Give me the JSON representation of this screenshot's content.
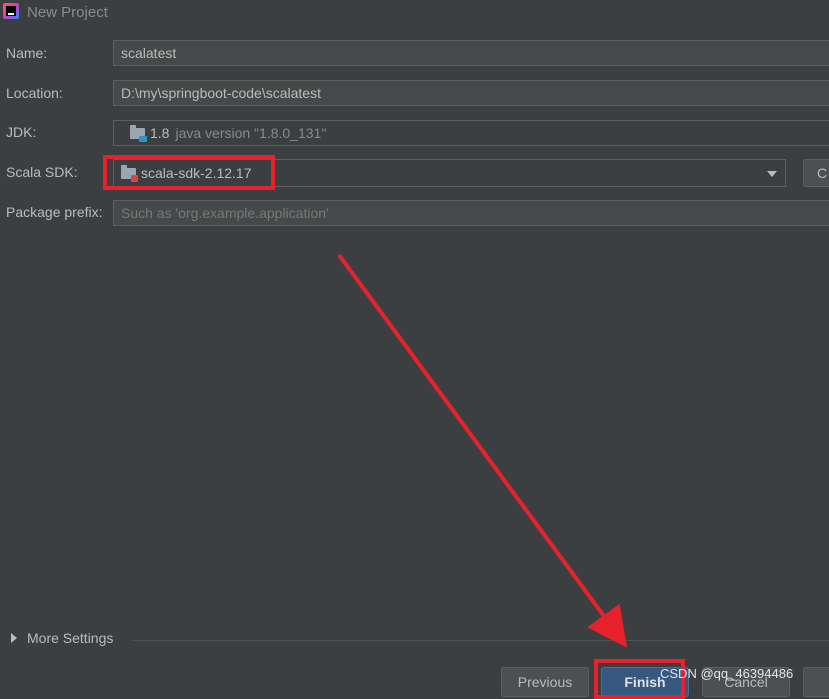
{
  "window": {
    "title": "New Project",
    "icon": "intellij-idea-icon"
  },
  "form": {
    "name": {
      "label": "Name:",
      "value": "scalatest"
    },
    "location": {
      "label": "Location:",
      "value": "D:\\my\\springboot-code\\scalatest"
    },
    "jdk": {
      "label": "JDK:",
      "version": "1.8",
      "detail": "java version \"1.8.0_131\"",
      "icon": "jdk-folder-icon"
    },
    "scala_sdk": {
      "label": "Scala SDK:",
      "value": "scala-sdk-2.12.17",
      "icon": "library-folder-icon",
      "create_label": "C"
    },
    "package_prefix": {
      "label": "Package prefix:",
      "placeholder": "Such as 'org.example.application'"
    }
  },
  "more_settings": {
    "label": "More Settings"
  },
  "buttons": {
    "previous": "Previous",
    "finish": "Finish",
    "cancel": "Cancel"
  },
  "watermark": "CSDN @qq_46394486",
  "annotation_color": "#e8222c"
}
